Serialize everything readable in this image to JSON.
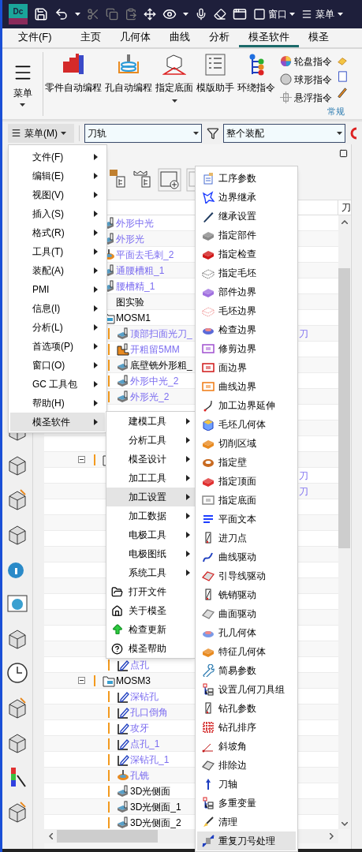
{
  "title_bar": {
    "logo": "Dc",
    "window_menu": "窗口",
    "menu_label": "菜单"
  },
  "tabs": [
    {
      "label": "文件(F)",
      "selected": false
    },
    {
      "label": "主页",
      "selected": false
    },
    {
      "label": "几何体",
      "selected": false
    },
    {
      "label": "曲线",
      "selected": false
    },
    {
      "label": "分析",
      "selected": false
    },
    {
      "label": "模圣软件",
      "selected": true
    },
    {
      "label": "模圣",
      "selected": false
    }
  ],
  "ribbon": {
    "menu_button": "菜单",
    "large_buttons": [
      {
        "label": "零件自动编程",
        "dropdown": false
      },
      {
        "label": "孔自动编程",
        "dropdown": false
      },
      {
        "label": "指定底面",
        "dropdown": true
      },
      {
        "label": "模版助手",
        "dropdown": false
      },
      {
        "label": "环绕指令",
        "dropdown": false
      }
    ],
    "small_buttons": [
      {
        "label": "轮盘指令"
      },
      {
        "label": "球形指令"
      },
      {
        "label": "悬浮指令"
      }
    ],
    "group_label": "常规"
  },
  "toolbar": {
    "menu_button": "菜单(M)",
    "type_filter": "刀轨",
    "scope": "整个装配"
  },
  "navigator": {
    "column_header": "刀",
    "tree": [
      {
        "kind": "mill",
        "name": "外形中光",
        "highlighted": true
      },
      {
        "kind": "mill",
        "name": "外形光",
        "highlighted": true
      },
      {
        "kind": "ring",
        "name": "平面去毛刺_2",
        "highlighted": true
      },
      {
        "kind": "mill",
        "name": "通腰槽粗_1",
        "highlighted": true
      },
      {
        "kind": "mill",
        "name": "腰槽精_1",
        "highlighted": true
      },
      {
        "kind": "covered",
        "name": "图实验",
        "highlighted": false
      },
      {
        "kind": "folder",
        "name": "MOSM1",
        "highlighted": false,
        "children": [
          {
            "kind": "mill",
            "name": "顶部扫面光刀_",
            "highlighted": true,
            "warning": true,
            "tail": "刀"
          },
          {
            "kind": "rough",
            "name": "开粗留5MM",
            "highlighted": true,
            "warning": true
          },
          {
            "kind": "mill",
            "name": "底壁铣外形粗_",
            "highlighted": false,
            "warning": true
          },
          {
            "kind": "mill",
            "name": "外形中光_2",
            "highlighted": true,
            "warning": true
          },
          {
            "kind": "mill",
            "name": "外形光_2",
            "highlighted": true,
            "warning": true
          },
          {
            "kind": "covered"
          },
          {
            "kind": "covered"
          },
          {
            "kind": "covered"
          }
        ]
      },
      {
        "kind": "folder",
        "expanded": true,
        "warning": true,
        "children": [
          {
            "kind": "covered",
            "tail": "刀"
          },
          {
            "kind": "covered",
            "tail": "刀"
          },
          {
            "kind": "covered"
          },
          {
            "kind": "covered"
          },
          {
            "kind": "covered"
          },
          {
            "kind": "covered"
          },
          {
            "kind": "covered"
          },
          {
            "kind": "covered"
          },
          {
            "kind": "covered"
          },
          {
            "kind": "covered"
          },
          {
            "kind": "covered"
          },
          {
            "kind": "covered"
          },
          {
            "kind": "drill",
            "name": "点孔",
            "highlighted": true,
            "warning": true
          }
        ]
      },
      {
        "kind": "folder",
        "name": "MOSM3",
        "highlighted": false,
        "expanded": true,
        "warning": true,
        "children": [
          {
            "kind": "drill",
            "name": "深钻孔",
            "highlighted": true,
            "warning": true
          },
          {
            "kind": "drill",
            "name": "孔口倒角",
            "highlighted": true,
            "warning": true
          },
          {
            "kind": "drill",
            "name": "攻牙",
            "highlighted": true,
            "warning": true
          },
          {
            "kind": "drill",
            "name": "点孔_1",
            "highlighted": true,
            "warning": true
          },
          {
            "kind": "drill",
            "name": "深钻孔_1",
            "highlighted": true,
            "warning": true
          },
          {
            "kind": "ring",
            "name": "孔铣",
            "highlighted": true,
            "warning": true
          },
          {
            "kind": "mill",
            "name": "3D光侧面",
            "highlighted": false,
            "warning": true
          },
          {
            "kind": "mill",
            "name": "3D光侧面_1",
            "highlighted": false,
            "warning": true
          },
          {
            "kind": "mill",
            "name": "3D光侧面_2",
            "highlighted": false,
            "warning": true
          }
        ]
      }
    ]
  },
  "menus": [
    {
      "items": [
        {
          "label": "文件(F)",
          "kind": "submenu",
          "selected": false
        },
        {
          "label": "编辑(E)",
          "kind": "submenu",
          "selected": false
        },
        {
          "label": "视图(V)",
          "kind": "submenu",
          "selected": false
        },
        {
          "label": "插入(S)",
          "kind": "submenu",
          "selected": false
        },
        {
          "label": "格式(R)",
          "kind": "submenu",
          "selected": false
        },
        {
          "label": "工具(T)",
          "kind": "submenu",
          "selected": false
        },
        {
          "label": "装配(A)",
          "kind": "submenu",
          "selected": false
        },
        {
          "label": "PMI",
          "kind": "submenu",
          "selected": false
        },
        {
          "label": "信息(I)",
          "kind": "submenu",
          "selected": false
        },
        {
          "label": "分析(L)",
          "kind": "submenu",
          "selected": false
        },
        {
          "label": "首选项(P)",
          "kind": "submenu",
          "selected": false
        },
        {
          "label": "窗口(O)",
          "kind": "submenu",
          "selected": false
        },
        {
          "label": "GC 工具包",
          "kind": "submenu",
          "selected": false
        },
        {
          "label": "帮助(H)",
          "kind": "submenu",
          "selected": false
        },
        {
          "label": "模圣软件",
          "kind": "submenu",
          "selected": true
        }
      ]
    },
    {
      "items": [
        {
          "label": "建模工具",
          "kind": "submenu",
          "selected": false
        },
        {
          "label": "分析工具",
          "kind": "submenu",
          "selected": false
        },
        {
          "label": "模圣设计",
          "kind": "submenu",
          "selected": false
        },
        {
          "label": "加工工具",
          "kind": "submenu",
          "selected": false
        },
        {
          "label": "加工设置",
          "kind": "submenu",
          "selected": true
        },
        {
          "label": "加工数据",
          "kind": "submenu",
          "selected": false
        },
        {
          "label": "电极工具",
          "kind": "submenu",
          "selected": false
        },
        {
          "label": "电极图纸",
          "kind": "submenu",
          "selected": false
        },
        {
          "label": "系统工具",
          "kind": "submenu",
          "selected": false
        },
        {
          "label": "打开文件",
          "kind": "command",
          "selected": false
        },
        {
          "label": "关于模圣",
          "kind": "command",
          "selected": false
        },
        {
          "label": "检查更新",
          "kind": "command",
          "selected": false
        },
        {
          "label": "模圣帮助",
          "kind": "command",
          "selected": false
        }
      ]
    },
    {
      "items": [
        {
          "label": "工序参数",
          "selected": false
        },
        {
          "label": "边界继承",
          "selected": false
        },
        {
          "label": "继承设置",
          "selected": false
        },
        {
          "label": "指定部件",
          "selected": false
        },
        {
          "label": "指定检查",
          "selected": false
        },
        {
          "label": "指定毛坯",
          "selected": false
        },
        {
          "label": "部件边界",
          "selected": false
        },
        {
          "label": "毛坯边界",
          "selected": false
        },
        {
          "label": "检查边界",
          "selected": false
        },
        {
          "label": "修剪边界",
          "selected": false
        },
        {
          "label": "面边界",
          "selected": false
        },
        {
          "label": "曲线边界",
          "selected": false
        },
        {
          "label": "加工边界延伸",
          "selected": false
        },
        {
          "label": "毛坯几何体",
          "selected": false
        },
        {
          "label": "切削区域",
          "selected": false
        },
        {
          "label": "指定壁",
          "selected": false
        },
        {
          "label": "指定顶面",
          "selected": false
        },
        {
          "label": "指定底面",
          "selected": false
        },
        {
          "label": "平面文本",
          "selected": false
        },
        {
          "label": "进刀点",
          "selected": false
        },
        {
          "label": "曲线驱动",
          "selected": false
        },
        {
          "label": "引导线驱动",
          "selected": false
        },
        {
          "label": "铣销驱动",
          "selected": false
        },
        {
          "label": "曲面驱动",
          "selected": false
        },
        {
          "label": "孔几何体",
          "selected": false
        },
        {
          "label": "特征几何体",
          "selected": false
        },
        {
          "label": "简易参数",
          "selected": false
        },
        {
          "label": "设置几何刀具组",
          "selected": false
        },
        {
          "label": "钻孔参数",
          "selected": false
        },
        {
          "label": "钻孔排序",
          "selected": false
        },
        {
          "label": "斜坡角",
          "selected": false
        },
        {
          "label": "排除边",
          "selected": false
        },
        {
          "label": "刀轴",
          "selected": false
        },
        {
          "label": "多重变量",
          "selected": false
        },
        {
          "label": "清理",
          "selected": false
        },
        {
          "label": "重复刀号处理",
          "selected": true
        }
      ]
    }
  ]
}
